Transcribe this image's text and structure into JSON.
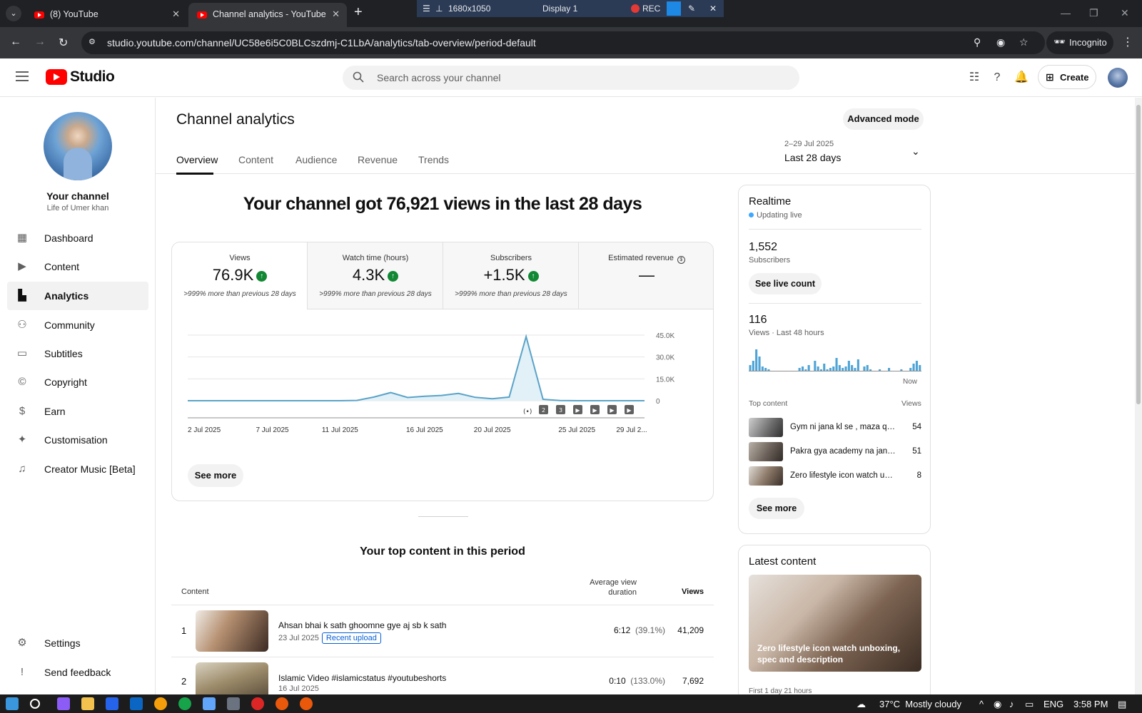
{
  "browser": {
    "tabs": [
      {
        "title": "(8) YouTube"
      },
      {
        "title": "Channel analytics - YouTube Studio"
      }
    ],
    "recording_bar": {
      "resolution": "1680x1050",
      "display": "Display 1",
      "rec": "REC"
    },
    "url": "studio.youtube.com/channel/UC58e6i5C0BLCszdmj-C1LbA/analytics/tab-overview/period-default",
    "incognito_label": "Incognito"
  },
  "header": {
    "logo_text": "Studio",
    "search_placeholder": "Search across your channel",
    "create_label": "Create"
  },
  "sidebar": {
    "channel_title": "Your channel",
    "channel_name": "Life of Umer khan",
    "items": [
      {
        "label": "Dashboard",
        "icon": "dashboard-icon"
      },
      {
        "label": "Content",
        "icon": "content-icon"
      },
      {
        "label": "Analytics",
        "icon": "analytics-icon",
        "active": true
      },
      {
        "label": "Community",
        "icon": "community-icon"
      },
      {
        "label": "Subtitles",
        "icon": "subtitles-icon"
      },
      {
        "label": "Copyright",
        "icon": "copyright-icon"
      },
      {
        "label": "Earn",
        "icon": "earn-icon"
      },
      {
        "label": "Customisation",
        "icon": "customisation-icon"
      },
      {
        "label": "Creator Music [Beta]",
        "icon": "creator-music-icon"
      }
    ],
    "bottom_items": [
      {
        "label": "Settings",
        "icon": "settings-icon"
      },
      {
        "label": "Send feedback",
        "icon": "feedback-icon"
      }
    ]
  },
  "main": {
    "title": "Channel analytics",
    "advanced_mode": "Advanced mode",
    "date_range": {
      "dates": "2–29 Jul 2025",
      "label": "Last 28 days"
    },
    "tabs": [
      "Overview",
      "Content",
      "Audience",
      "Revenue",
      "Trends"
    ],
    "headline": "Your channel got 76,921 views in the last 28 days",
    "metrics": [
      {
        "title": "Views",
        "value": "76.9K",
        "sub": ">999% more than previous 28 days",
        "trend": "up"
      },
      {
        "title": "Watch time (hours)",
        "value": "4.3K",
        "sub": ">999% more than previous 28 days",
        "trend": "up"
      },
      {
        "title": "Subscribers",
        "value": "+1.5K",
        "sub": ">999% more than previous 28 days",
        "trend": "up"
      },
      {
        "title": "Estimated revenue",
        "value": "—",
        "sub": "",
        "trend": "none"
      }
    ],
    "chart_see_more": "See more",
    "top_content_title": "Your top content in this period",
    "table_headers": {
      "content": "Content",
      "avg_duration": "Average view duration",
      "views": "Views"
    },
    "top_content": [
      {
        "rank": "1",
        "title": "Ahsan bhai k sath ghoomne gye aj sb k sath",
        "date": "23 Jul 2025",
        "badge": "Recent upload",
        "duration": "6:12",
        "duration_pct": "(39.1%)",
        "views": "41,209"
      },
      {
        "rank": "2",
        "title": "Islamic Video #islamicstatus #youtubeshorts",
        "date": "16 Jul 2025",
        "badge": "",
        "duration": "0:10",
        "duration_pct": "(133.0%)",
        "views": "7,692"
      }
    ]
  },
  "realtime": {
    "title": "Realtime",
    "status": "Updating live",
    "subscribers_value": "1,552",
    "subscribers_label": "Subscribers",
    "see_live_count": "See live count",
    "views_value": "116",
    "views_label": "Views · Last 48 hours",
    "now_label": "Now",
    "top_content_label": "Top content",
    "views_col_label": "Views",
    "top_content": [
      {
        "title": "Gym ni jana kl se , maza q gya",
        "views": "54"
      },
      {
        "title": "Pakra gya academy na jane ...",
        "views": "51"
      },
      {
        "title": "Zero lifestyle icon watch unb...",
        "views": "8"
      }
    ],
    "see_more": "See more",
    "bars_48h": [
      8,
      14,
      30,
      20,
      6,
      4,
      2,
      0,
      0,
      0,
      0,
      0,
      0,
      0,
      0,
      0,
      4,
      6,
      2,
      8,
      0,
      14,
      6,
      2,
      10,
      2,
      4,
      6,
      18,
      8,
      4,
      6,
      14,
      8,
      4,
      16,
      0,
      6,
      8,
      2,
      0,
      0,
      2,
      0,
      0,
      4,
      0,
      0,
      0,
      2,
      0,
      0,
      4,
      10,
      14,
      8
    ]
  },
  "latest_content": {
    "title": "Latest content",
    "video_caption": "Zero lifestyle icon watch unboxing, spec and description",
    "meta": "First 1 day 21 hours"
  },
  "chart_data": {
    "type": "area",
    "title": "",
    "x": [
      "2 Jul 2025",
      "3 Jul",
      "4 Jul",
      "5 Jul",
      "6 Jul",
      "7 Jul 2025",
      "8 Jul",
      "9 Jul",
      "10 Jul",
      "11 Jul 2025",
      "12 Jul",
      "13 Jul",
      "14 Jul",
      "15 Jul",
      "16 Jul 2025",
      "17 Jul",
      "18 Jul",
      "19 Jul",
      "20 Jul 2025",
      "21 Jul",
      "22 Jul",
      "23 Jul",
      "24 Jul",
      "25 Jul 2025",
      "26 Jul",
      "27 Jul",
      "28 Jul",
      "29 Jul 2025"
    ],
    "series": [
      {
        "values": [
          0,
          0,
          0,
          0,
          0,
          0,
          0,
          0,
          0,
          0,
          200,
          2500,
          5600,
          2200,
          3100,
          3600,
          5000,
          2300,
          1300,
          2500,
          44000,
          1000,
          100,
          0,
          0,
          0,
          0,
          0
        ]
      }
    ],
    "x_tick_labels": [
      "2 Jul 2025",
      "7 Jul 2025",
      "11 Jul 2025",
      "16 Jul 2025",
      "20 Jul 2025",
      "25 Jul 2025",
      "29 Jul 2..."
    ],
    "y_tick_labels": [
      "0",
      "15.0K",
      "30.0K",
      "45.0K"
    ],
    "ylim": [
      0,
      45000
    ],
    "grid": true,
    "color": "#5aa3c8",
    "fill_color": "#e2f0f7"
  },
  "colors": {
    "accent": "#ff0000",
    "up": "#118833",
    "link": "#065fd4",
    "live": "#3ea6ff"
  }
}
